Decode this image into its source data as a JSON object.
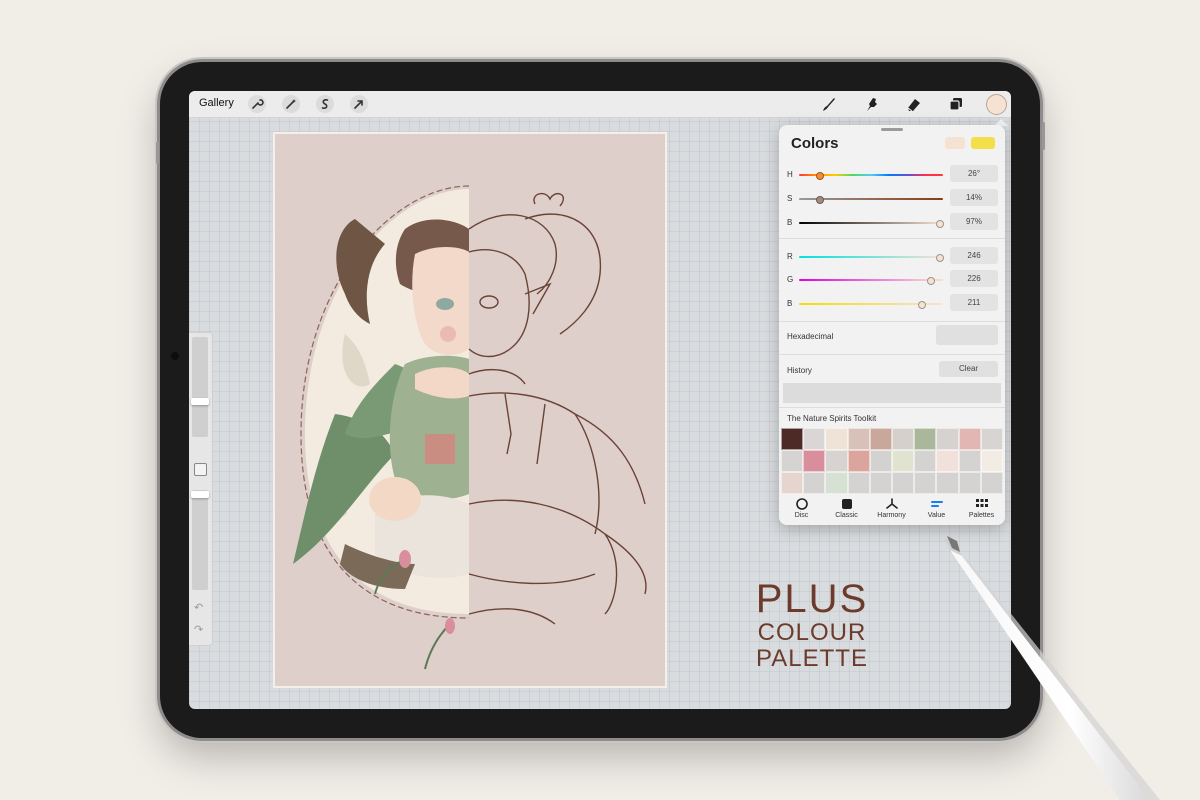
{
  "topbar": {
    "gallery_label": "Gallery",
    "left_tools": [
      "wrench-icon",
      "magic-wand-icon",
      "selection-icon",
      "transform-arrow-icon"
    ],
    "right_tools": [
      "brush-icon",
      "smudge-icon",
      "eraser-icon",
      "layers-icon"
    ],
    "current_color": "#f6e2d3"
  },
  "colors": {
    "title": "Colors",
    "current_swatch": "#f6e2d3",
    "previous_swatch": "#f2df4a",
    "hsb": [
      {
        "label": "H",
        "value": "26°",
        "level": 0.07
      },
      {
        "label": "S",
        "value": "14%",
        "level": 0.14
      },
      {
        "label": "B",
        "value": "97%",
        "level": 0.97
      }
    ],
    "rgb": [
      {
        "label": "R",
        "value": "246",
        "level": 0.96
      },
      {
        "label": "G",
        "value": "226",
        "level": 0.89
      },
      {
        "label": "B",
        "value": "211",
        "level": 0.83
      }
    ],
    "hexadecimal_label": "Hexadecimal",
    "history_label": "History",
    "clear_label": "Clear",
    "palette_name": "The Nature Spirits Toolkit",
    "palette": [
      "#4e2a27",
      "#d9d6d5",
      "#efe2d7",
      "#d8c1b8",
      "#c9a79a",
      "#d6d0cd",
      "#aab79b",
      "#d6d2d0",
      "#e2b6b2",
      "#d7d4d2",
      "#d6d4d3",
      "#d98e9c",
      "#d6d3d1",
      "#dba49c",
      "#d4d2d1",
      "#dfe3d0",
      "#d4d3d2",
      "#f2e1db",
      "#d5d3d2",
      "#f3ece4",
      "#e6d5cf",
      "#d5d3d2",
      "#d6e0d3",
      "#d5d3d2",
      "#d5d3d2",
      "#d5d3d2",
      "#d5d3d2",
      "#d5d3d2",
      "#d5d3d2",
      "#d5d3d2"
    ],
    "tabs": [
      {
        "label": "Disc",
        "icon": "disc-icon"
      },
      {
        "label": "Classic",
        "icon": "classic-square-icon"
      },
      {
        "label": "Harmony",
        "icon": "harmony-icon"
      },
      {
        "label": "Value",
        "icon": "value-sliders-icon"
      },
      {
        "label": "Palettes",
        "icon": "palettes-grid-icon"
      }
    ],
    "active_tab": "Value"
  },
  "headline": {
    "line1": "PLUS",
    "line2": "COLOUR PALETTE"
  },
  "accent_color": "#6d3b2c"
}
